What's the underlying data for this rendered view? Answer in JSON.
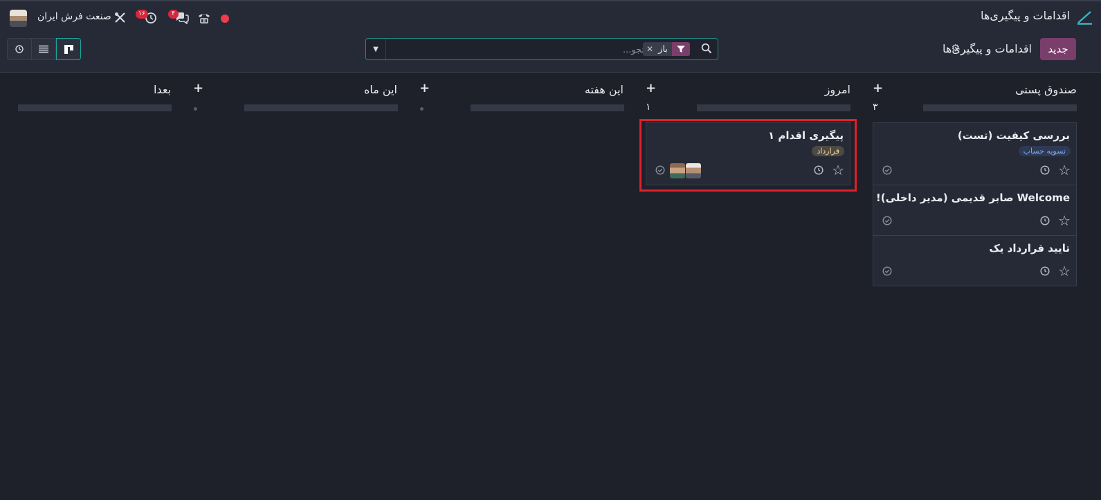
{
  "topbar": {
    "app_title": "اقدامات و پیگیری‌ها",
    "company": "صنعت فرش ایران",
    "activity_badge": "۱۶",
    "messages_badge": "۴"
  },
  "controls": {
    "new_label": "جدید",
    "view_title": "اقدامات و پیگیری‌ها",
    "search_placeholder": "جستجو...",
    "facet_value": "باز"
  },
  "columns": [
    {
      "title": "صندوق پستی",
      "count": "۳",
      "cards": [
        {
          "title": "بررسی کیفیت (تست)",
          "tag": "تسویه حساب"
        },
        {
          "title": "Welcome صابر قدیمی (مدیر داخلی)!"
        },
        {
          "title": "تایید قرارداد یک"
        }
      ]
    },
    {
      "title": "امروز",
      "count": "۱",
      "cards": [
        {
          "title": "پیگیری اقدام ۱",
          "tag": "قرارداد"
        }
      ]
    },
    {
      "title": "این هفته",
      "count": ""
    },
    {
      "title": "این ماه",
      "count": ""
    },
    {
      "title": "بعدا",
      "count": ""
    }
  ],
  "colors": {
    "accent": "#7a3e6b",
    "focus_teal": "#1aa79b",
    "highlight_red": "#e0202a",
    "badge_red": "#d7263d"
  }
}
